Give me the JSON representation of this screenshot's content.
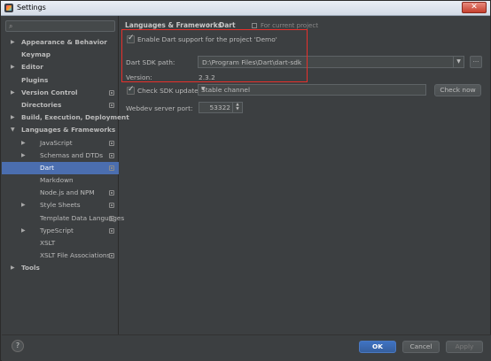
{
  "window": {
    "title": "Settings"
  },
  "sidebar": {
    "search_placeholder": "",
    "items": [
      {
        "label": "Appearance & Behavior",
        "arrow": "▶",
        "bold": true,
        "level": 0
      },
      {
        "label": "Keymap",
        "arrow": "",
        "bold": true,
        "level": 0
      },
      {
        "label": "Editor",
        "arrow": "▶",
        "bold": true,
        "level": 0
      },
      {
        "label": "Plugins",
        "arrow": "",
        "bold": true,
        "level": 0
      },
      {
        "label": "Version Control",
        "arrow": "▶",
        "bold": true,
        "level": 0,
        "project": true
      },
      {
        "label": "Directories",
        "arrow": "",
        "bold": true,
        "level": 0,
        "project": true
      },
      {
        "label": "Build, Execution, Deployment",
        "arrow": "▶",
        "bold": true,
        "level": 0
      },
      {
        "label": "Languages & Frameworks",
        "arrow": "▼",
        "bold": true,
        "level": 0
      },
      {
        "label": "JavaScript",
        "arrow": "▶",
        "bold": false,
        "level": 1,
        "project": true
      },
      {
        "label": "Schemas and DTDs",
        "arrow": "▶",
        "bold": false,
        "level": 1,
        "project": true
      },
      {
        "label": "Dart",
        "arrow": "",
        "bold": false,
        "level": 1,
        "project": true,
        "selected": true
      },
      {
        "label": "Markdown",
        "arrow": "",
        "bold": false,
        "level": 1
      },
      {
        "label": "Node.js and NPM",
        "arrow": "",
        "bold": false,
        "level": 1,
        "project": true
      },
      {
        "label": "Style Sheets",
        "arrow": "▶",
        "bold": false,
        "level": 1,
        "project": true
      },
      {
        "label": "Template Data Languages",
        "arrow": "",
        "bold": false,
        "level": 1,
        "project": true
      },
      {
        "label": "TypeScript",
        "arrow": "▶",
        "bold": false,
        "level": 1,
        "project": true
      },
      {
        "label": "XSLT",
        "arrow": "",
        "bold": false,
        "level": 1
      },
      {
        "label": "XSLT File Associations",
        "arrow": "",
        "bold": false,
        "level": 1,
        "project": true
      },
      {
        "label": "Tools",
        "arrow": "▶",
        "bold": true,
        "level": 0
      }
    ]
  },
  "breadcrumb": {
    "parent": "Languages & Frameworks",
    "separator": "›",
    "current": "Dart",
    "note": "For current project"
  },
  "dart": {
    "enable_label": "Enable Dart support for the project 'Demo'",
    "sdk_path_label": "Dart SDK path:",
    "sdk_path_value": "D:\\Program Files\\Dart\\dart-sdk",
    "browse_label": "...",
    "version_label": "Version:",
    "version_value": "2.3.2",
    "check_update_label": "Check SDK update:",
    "channel_value": "Stable channel",
    "check_now_label": "Check now",
    "webdev_port_label": "Webdev server port:",
    "webdev_port_value": "53322"
  },
  "footer": {
    "help": "?",
    "ok": "OK",
    "cancel": "Cancel",
    "apply": "Apply"
  },
  "colors": {
    "background": "#3c3f41",
    "selection": "#4b6eaf",
    "highlight_box": "#e8302b",
    "ok_button": "#365f9e"
  }
}
